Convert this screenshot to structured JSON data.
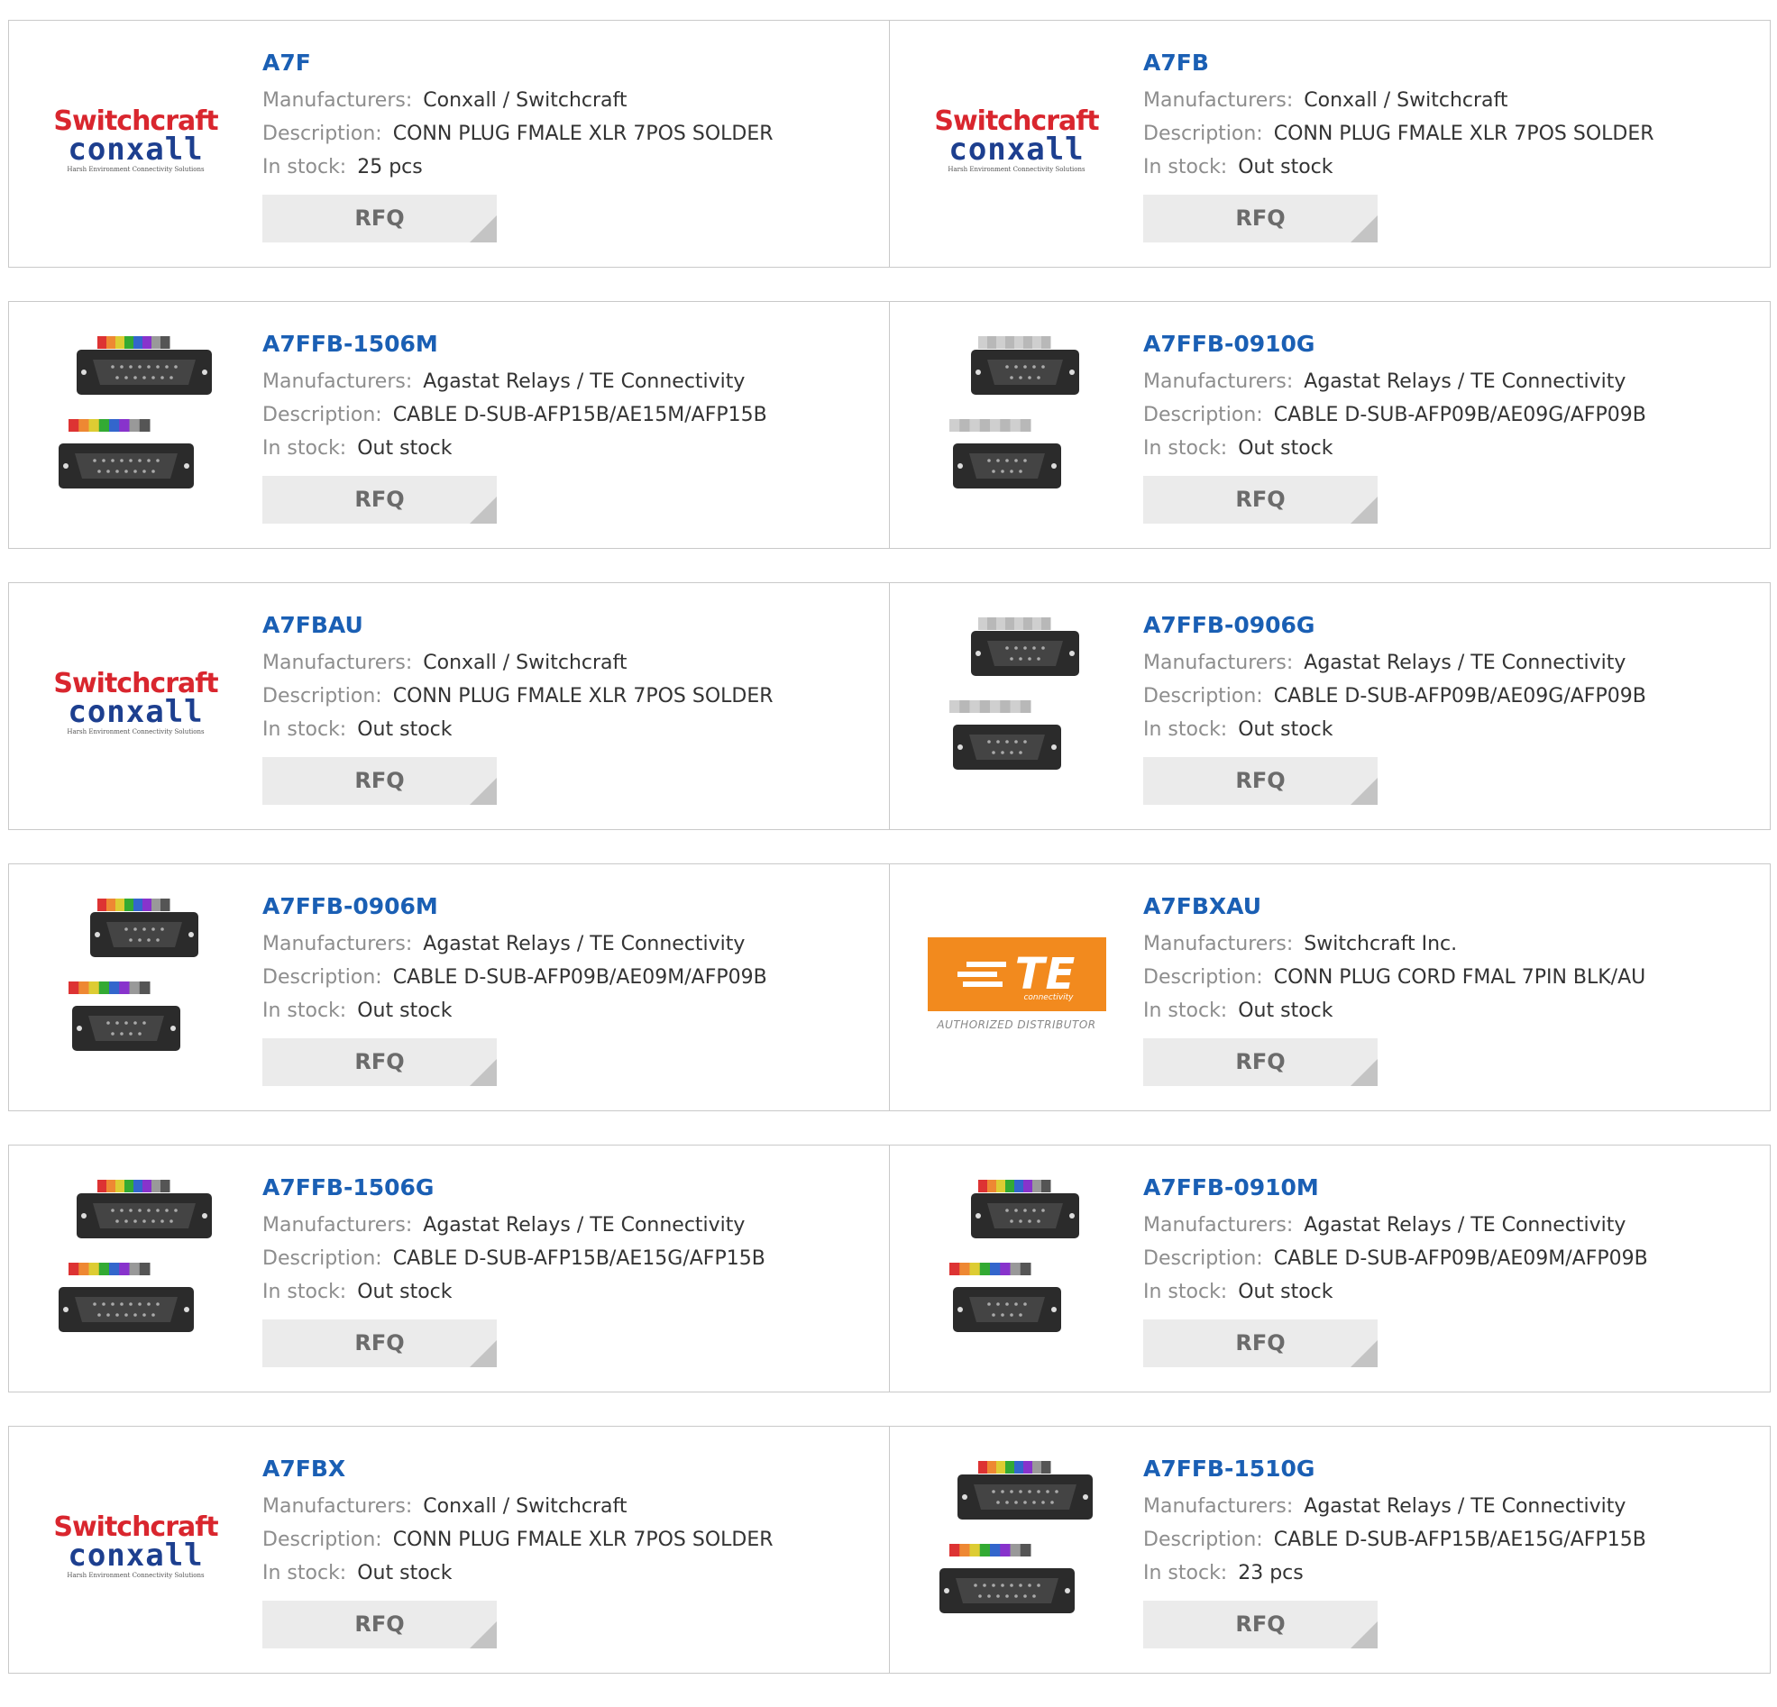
{
  "labels": {
    "manufacturers": "Manufacturers:",
    "description": "Description:",
    "in_stock": "In stock:",
    "rfq": "RFQ"
  },
  "colors": {
    "part_number": "#1a5fb4",
    "label": "#8d8d8d",
    "value": "#333333",
    "rfq_bg": "#ebebeb"
  },
  "logos": {
    "switchcraft": {
      "top": "Switchcraft",
      "mid": "conxall",
      "tagline": "Harsh Environment Connectivity Solutions"
    },
    "te": {
      "main": "TE",
      "sub": "connectivity",
      "caption": "AUTHORIZED DISTRIBUTOR"
    }
  },
  "products": [
    {
      "part": "A7F",
      "manufacturer": "Conxall / Switchcraft",
      "description": "CONN PLUG FMALE XLR 7POS SOLDER",
      "stock": "25 pcs",
      "image": "switchcraft-logo"
    },
    {
      "part": "A7FB",
      "manufacturer": "Conxall / Switchcraft",
      "description": "CONN PLUG FMALE XLR 7POS SOLDER",
      "stock": "Out stock",
      "image": "switchcraft-logo"
    },
    {
      "part": "A7FFB-1506M",
      "manufacturer": "Agastat Relays / TE Connectivity",
      "description": "CABLE D-SUB-AFP15B/AE15M/AFP15B",
      "stock": "Out stock",
      "image": "dsub-15-cable"
    },
    {
      "part": "A7FFB-0910G",
      "manufacturer": "Agastat Relays / TE Connectivity",
      "description": "CABLE D-SUB-AFP09B/AE09G/AFP09B",
      "stock": "Out stock",
      "image": "dsub-9-cable"
    },
    {
      "part": "A7FBAU",
      "manufacturer": "Conxall / Switchcraft",
      "description": "CONN PLUG FMALE XLR 7POS SOLDER",
      "stock": "Out stock",
      "image": "switchcraft-logo"
    },
    {
      "part": "A7FFB-0906G",
      "manufacturer": "Agastat Relays / TE Connectivity",
      "description": "CABLE D-SUB-AFP09B/AE09G/AFP09B",
      "stock": "Out stock",
      "image": "dsub-9-cable"
    },
    {
      "part": "A7FFB-0906M",
      "manufacturer": "Agastat Relays / TE Connectivity",
      "description": "CABLE D-SUB-AFP09B/AE09M/AFP09B",
      "stock": "Out stock",
      "image": "dsub-9-cable-color"
    },
    {
      "part": "A7FBXAU",
      "manufacturer": "Switchcraft Inc.",
      "description": "CONN PLUG CORD FMAL 7PIN BLK/AU",
      "stock": "Out stock",
      "image": "te-logo"
    },
    {
      "part": "A7FFB-1506G",
      "manufacturer": "Agastat Relays / TE Connectivity",
      "description": "CABLE D-SUB-AFP15B/AE15G/AFP15B",
      "stock": "Out stock",
      "image": "dsub-15-cable"
    },
    {
      "part": "A7FFB-0910M",
      "manufacturer": "Agastat Relays / TE Connectivity",
      "description": "CABLE D-SUB-AFP09B/AE09M/AFP09B",
      "stock": "Out stock",
      "image": "dsub-9-cable-color"
    },
    {
      "part": "A7FBX",
      "manufacturer": "Conxall / Switchcraft",
      "description": "CONN PLUG FMALE XLR 7POS SOLDER",
      "stock": "Out stock",
      "image": "switchcraft-logo"
    },
    {
      "part": "A7FFB-1510G",
      "manufacturer": "Agastat Relays / TE Connectivity",
      "description": "CABLE D-SUB-AFP15B/AE15G/AFP15B",
      "stock": "23 pcs",
      "image": "dsub-15-cable"
    }
  ]
}
